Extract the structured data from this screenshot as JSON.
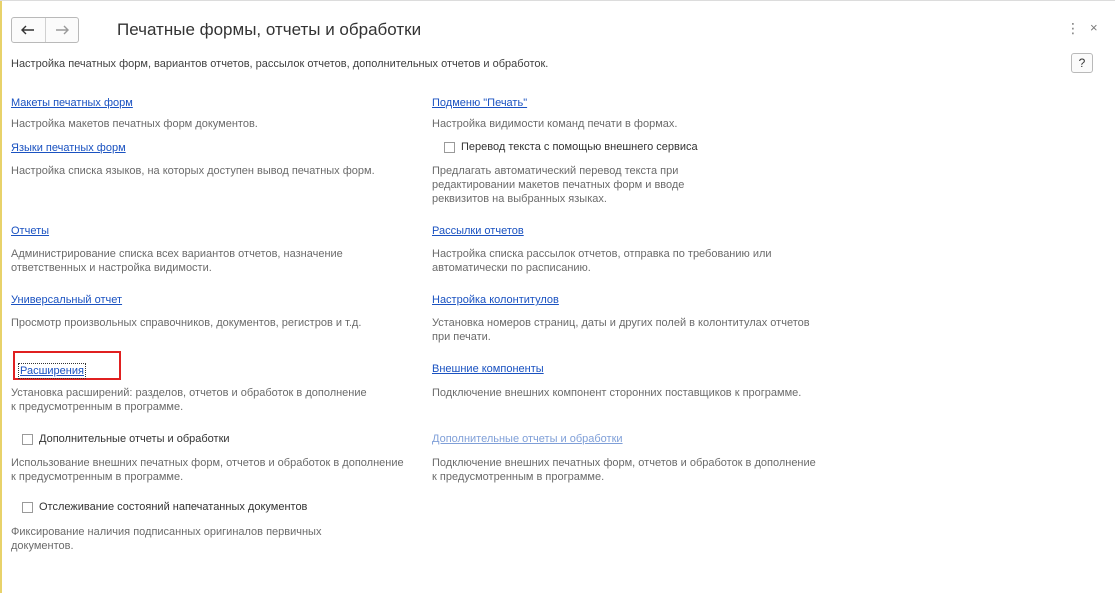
{
  "header": {
    "title": "Печатные формы, отчеты и обработки",
    "back_icon": "←",
    "forward_icon": "→",
    "more_icon": "⋮",
    "close_icon": "×"
  },
  "subtitle": "Настройка печатных форм, вариантов отчетов, рассылок отчетов, дополнительных отчетов и обработок.",
  "help_label": "?",
  "left": {
    "print_layouts": {
      "link": "Макеты печатных форм",
      "desc": "Настройка макетов печатных форм документов."
    },
    "print_languages": {
      "link": "Языки печатных форм",
      "desc": "Настройка списка языков, на которых доступен вывод печатных форм."
    },
    "reports": {
      "link": "Отчеты",
      "desc": "Администрирование списка всех вариантов отчетов, назначение ответственных и настройка видимости."
    },
    "universal_report": {
      "link": "Универсальный отчет",
      "desc": "Просмотр произвольных справочников, документов, регистров и т.д."
    },
    "extensions": {
      "link": "Расширения",
      "desc": "Установка расширений: разделов, отчетов и обработок в дополнение к предусмотренным в программе."
    },
    "additional_reports": {
      "checkbox": "Дополнительные отчеты и обработки",
      "checked": false,
      "desc": "Использование внешних печатных форм, отчетов и обработок в дополнение к предусмотренным в программе."
    },
    "tracking": {
      "checkbox": "Отслеживание состояний напечатанных документов",
      "checked": false,
      "desc": "Фиксирование наличия подписанных оригиналов первичных документов."
    }
  },
  "right": {
    "print_submenu": {
      "link": "Подменю \"Печать\"",
      "desc": "Настройка видимости команд печати в формах."
    },
    "translation": {
      "checkbox": "Перевод текста с помощью внешнего сервиса",
      "checked": false,
      "desc": "Предлагать автоматический перевод текста при редактировании макетов печатных форм и вводе реквизитов на выбранных языках."
    },
    "mailings": {
      "link": "Рассылки отчетов",
      "desc": "Настройка списка рассылок отчетов, отправка по требованию или автоматически по расписанию."
    },
    "headers_footers": {
      "link": "Настройка колонтитулов",
      "desc": "Установка номеров страниц, даты и других полей в колонтитулах отчетов при печати."
    },
    "external_components": {
      "link": "Внешние компоненты",
      "desc": "Подключение внешних компонент сторонних поставщиков к программе."
    },
    "additional_reports": {
      "link": "Дополнительные отчеты и обработки",
      "desc": "Подключение внешних печатных форм, отчетов и обработок в дополнение к предусмотренным в программе."
    }
  },
  "colors": {
    "link": "#1a52c1",
    "link_disabled": "#7f9fd8",
    "highlight": "#e02020",
    "accent": "#e8d26a"
  }
}
